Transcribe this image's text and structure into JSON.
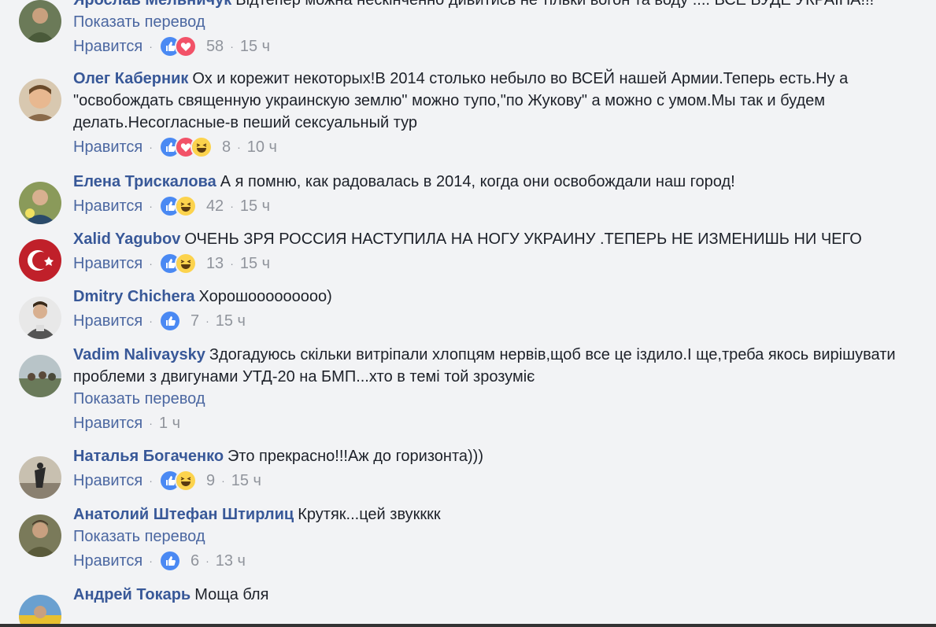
{
  "comments": [
    {
      "author": "Ярослав Мельничук",
      "text": "Відтепер можна нескінченно дивитись не тільки вогон та воду .... ВСЕ БУДЕ УКРАЇНА!!!",
      "translate": "Показать перевод",
      "like": "Нравится",
      "reactions": [
        "like-icon",
        "love-icon"
      ],
      "count": "58",
      "time": "15 ч",
      "avatar_color": "#4a5a3a"
    },
    {
      "author": "Олег Каберник",
      "text": "Ох и корежит некоторых!В 2014 столько небыло во ВСЕЙ нашей Армии.Теперь есть.Ну а \"освобождать священную украинскую землю\" можно тупо,\"по Жукову\" а можно с умом.Мы так и будем делать.Несогласные-в пеший сексуальный тур",
      "translate": "",
      "like": "Нравится",
      "reactions": [
        "like-icon",
        "love-icon",
        "haha-icon"
      ],
      "count": "8",
      "time": "10 ч",
      "avatar_color": "#b88a66"
    },
    {
      "author": "Елена Трискалова",
      "text": "А я помню, как радовалась в 2014, когда они освобождали наш город!",
      "translate": "",
      "like": "Нравится",
      "reactions": [
        "like-icon",
        "haha-icon"
      ],
      "count": "42",
      "time": "15 ч",
      "avatar_color": "#7a8a4a"
    },
    {
      "author": "Xalid Yagubov",
      "text": "ОЧЕНЬ ЗРЯ РОССИЯ НАСТУПИЛА НА НОГУ УКРАИНУ .ТЕПЕРЬ НЕ ИЗМЕНИШЬ НИ ЧЕГО",
      "translate": "",
      "like": "Нравится",
      "reactions": [
        "like-icon",
        "haha-icon"
      ],
      "count": "13",
      "time": "15 ч",
      "avatar_color": "#c0202a"
    },
    {
      "author": "Dmitry Chichera",
      "text": "Хорошооооооооо)",
      "translate": "",
      "like": "Нравится",
      "reactions": [
        "like-icon"
      ],
      "count": "7",
      "time": "15 ч",
      "avatar_color": "#dcdcdc"
    },
    {
      "author": "Vadim Nalivaysky",
      "text": "Здогадуюсь скільки витріпали хлопцям нервів,щоб все це іздило.І ще,треба якось вирішувати проблеми з двигунами УТД-20 на БМП...хто в темі той зрозуміє",
      "translate": "Показать перевод",
      "like": "Нравится",
      "reactions": [],
      "count": "",
      "time": "1 ч",
      "avatar_color": "#8a9a8a"
    },
    {
      "author": "Наталья Богаченко",
      "text": "Это прекрасно!!!Аж до горизонта)))",
      "translate": "",
      "like": "Нравится",
      "reactions": [
        "like-icon",
        "haha-icon"
      ],
      "count": "9",
      "time": "15 ч",
      "avatar_color": "#9a9080"
    },
    {
      "author": "Анатолий Штефан Штирлиц",
      "text": "Крутяк...цей звукккк",
      "translate": "Показать перевод",
      "like": "Нравится",
      "reactions": [
        "like-icon"
      ],
      "count": "6",
      "time": "13 ч",
      "avatar_color": "#5a5a3a"
    },
    {
      "author": "Андрей Токарь",
      "text": "Моща бля",
      "translate": "",
      "like": "",
      "reactions": [],
      "count": "",
      "time": "",
      "avatar_color": "#d4b030"
    }
  ]
}
